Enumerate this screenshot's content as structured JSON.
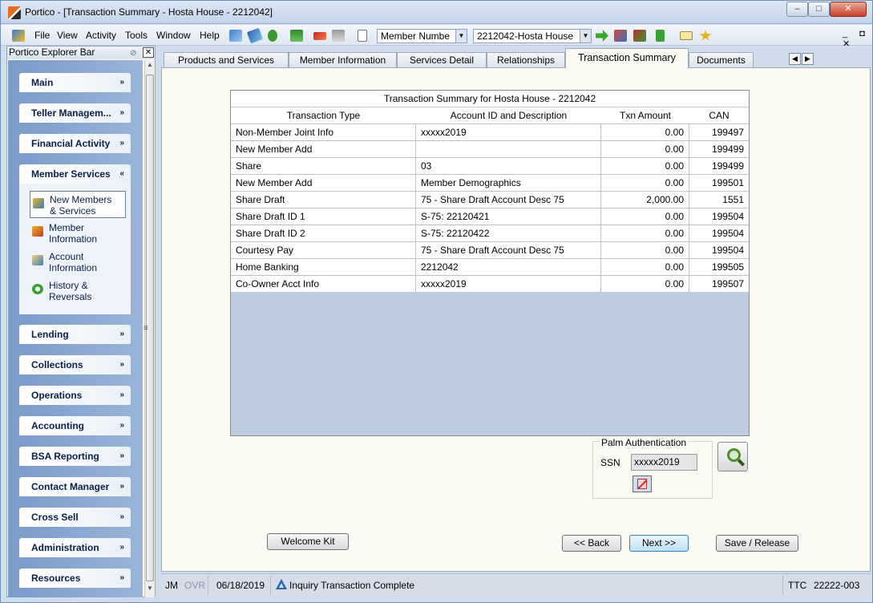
{
  "window": {
    "title": "Portico - [Transaction Summary - Hosta House - 2212042]",
    "controls": {
      "minimize": "–",
      "maximize": "□",
      "close": "✕"
    }
  },
  "menu": [
    "File",
    "View",
    "Activity",
    "Tools",
    "Window",
    "Help"
  ],
  "toolbar": {
    "search_type": "Member Numbe",
    "member_select": "2212042-Hosta House",
    "mdi_controls": "_ ◘ ✕"
  },
  "explorer": {
    "title": "Portico Explorer Bar",
    "sections": [
      {
        "label": "Main",
        "chevron": "»"
      },
      {
        "label": "Teller Managem...",
        "chevron": "»"
      },
      {
        "label": "Financial Activity",
        "chevron": "»"
      },
      {
        "label": "Member Services",
        "chevron": "«"
      },
      {
        "label": "Lending",
        "chevron": "»"
      },
      {
        "label": "Collections",
        "chevron": "»"
      },
      {
        "label": "Operations",
        "chevron": "»"
      },
      {
        "label": "Accounting",
        "chevron": "»"
      },
      {
        "label": "BSA Reporting",
        "chevron": "»"
      },
      {
        "label": "Contact Manager",
        "chevron": "»"
      },
      {
        "label": "Cross Sell",
        "chevron": "»"
      },
      {
        "label": "Administration",
        "chevron": "»"
      },
      {
        "label": "Resources",
        "chevron": "»"
      }
    ],
    "member_services_items": [
      {
        "line1": "New Members",
        "line2": "& Services",
        "icon": "new-members-icon"
      },
      {
        "line1": "Member",
        "line2": "Information",
        "icon": "member-info-icon"
      },
      {
        "line1": "Account",
        "line2": "Information",
        "icon": "account-info-icon"
      },
      {
        "line1": "History &",
        "line2": "Reversals",
        "icon": "history-icon"
      }
    ]
  },
  "tabs": [
    "Products and Services",
    "Member Information",
    "Services Detail",
    "Relationships",
    "Transaction Summary",
    "Documents"
  ],
  "active_tab": "Transaction Summary",
  "grid": {
    "caption": "Transaction Summary for Hosta House - 2212042",
    "columns": [
      "Transaction Type",
      "Account ID and Description",
      "Txn Amount",
      "CAN"
    ],
    "rows": [
      [
        "Non-Member Joint Info",
        "xxxxx2019",
        "0.00",
        "199497"
      ],
      [
        "New Member Add",
        "",
        "0.00",
        "199499"
      ],
      [
        "Share",
        "03",
        "0.00",
        "199499"
      ],
      [
        "New Member Add",
        "Member Demographics",
        "0.00",
        "199501"
      ],
      [
        "Share Draft",
        "75 - Share Draft Account Desc 75",
        "2,000.00",
        "1551"
      ],
      [
        "Share Draft ID 1",
        "S-75: 22120421",
        "0.00",
        "199504"
      ],
      [
        "Share Draft ID 2",
        "S-75: 22120422",
        "0.00",
        "199504"
      ],
      [
        "Courtesy Pay",
        "75 - Share Draft Account Desc 75",
        "0.00",
        "199504"
      ],
      [
        "Home Banking",
        "2212042",
        "0.00",
        "199505"
      ],
      [
        "Co-Owner Acct Info",
        "xxxxx2019",
        "0.00",
        "199507"
      ]
    ]
  },
  "palm": {
    "title": "Palm Authentication",
    "ssn_label": "SSN",
    "ssn_value": "xxxxx2019"
  },
  "buttons": {
    "welcome": "Welcome Kit",
    "back": "<< Back",
    "next": "Next >>",
    "save": "Save / Release"
  },
  "status": {
    "user": "JM",
    "ovr": "OVR",
    "date": "06/18/2019",
    "message": "Inquiry Transaction Complete",
    "ttc_label": "TTC",
    "ttc_value": "22222-003"
  },
  "colors": {
    "accent": "#7a9ac8",
    "grid_bg": "#bdcde0",
    "content_bg": "#fbfbf4"
  }
}
